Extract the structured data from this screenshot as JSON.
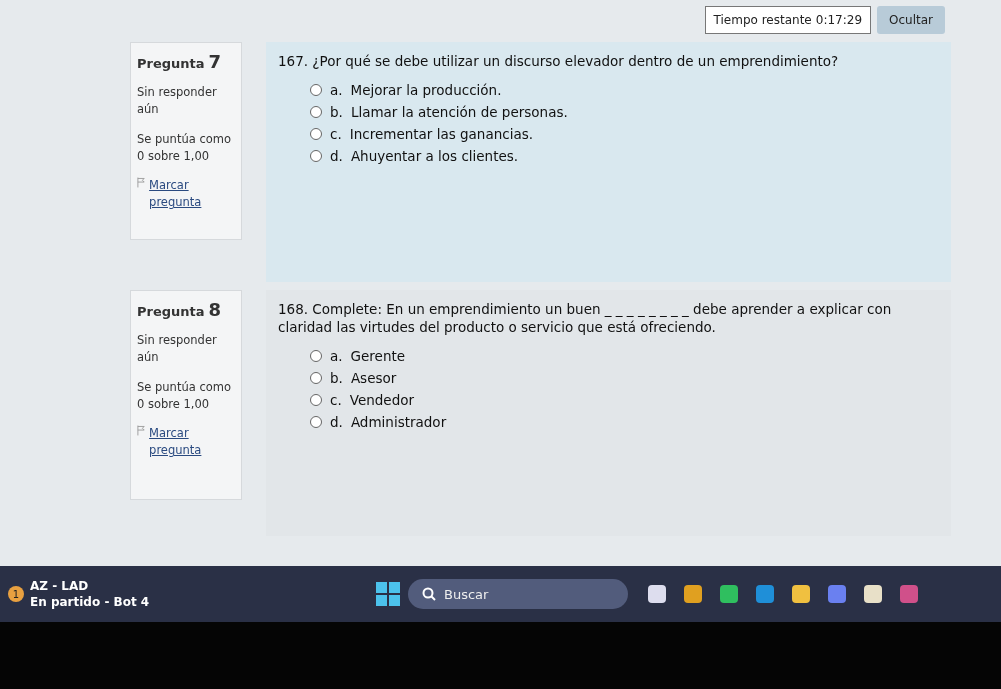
{
  "timer": {
    "label": "Tiempo restante",
    "time": "0:17:29"
  },
  "hide_button": "Ocultar",
  "questions": [
    {
      "title": "Pregunta",
      "number": "7",
      "status": "Sin responder aún",
      "grading": "Se puntúa como 0 sobre 1,00",
      "flag": "Marcar pregunta",
      "text": "167. ¿Por qué se debe utilizar un discurso elevador dentro de un emprendimiento?",
      "options": [
        {
          "letter": "a.",
          "text": "Mejorar la producción.",
          "selected": false
        },
        {
          "letter": "b.",
          "text": "Llamar la atención de personas.",
          "selected": false
        },
        {
          "letter": "c.",
          "text": "Incrementar las ganancias.",
          "selected": false
        },
        {
          "letter": "d.",
          "text": "Ahuyentar a los clientes.",
          "selected": false
        }
      ]
    },
    {
      "title": "Pregunta",
      "number": "8",
      "status": "Sin responder aún",
      "grading": "Se puntúa como 0 sobre 1,00",
      "flag": "Marcar pregunta",
      "text": "168. Complete: En un emprendimiento un buen _ _ _ _ _ _ _ _ debe aprender a explicar con claridad las virtudes del producto o servicio que está ofreciendo.",
      "options": [
        {
          "letter": "a.",
          "text": "Gerente",
          "selected": false
        },
        {
          "letter": "b.",
          "text": "Asesor",
          "selected": false
        },
        {
          "letter": "c.",
          "text": "Vendedor",
          "selected": false
        },
        {
          "letter": "d.",
          "text": "Administrador",
          "selected": false
        }
      ]
    }
  ],
  "taskbar": {
    "badge": "1",
    "app_title": "AZ - LAD",
    "app_subtitle": "En partido - Bot 4",
    "search_placeholder": "Buscar"
  }
}
